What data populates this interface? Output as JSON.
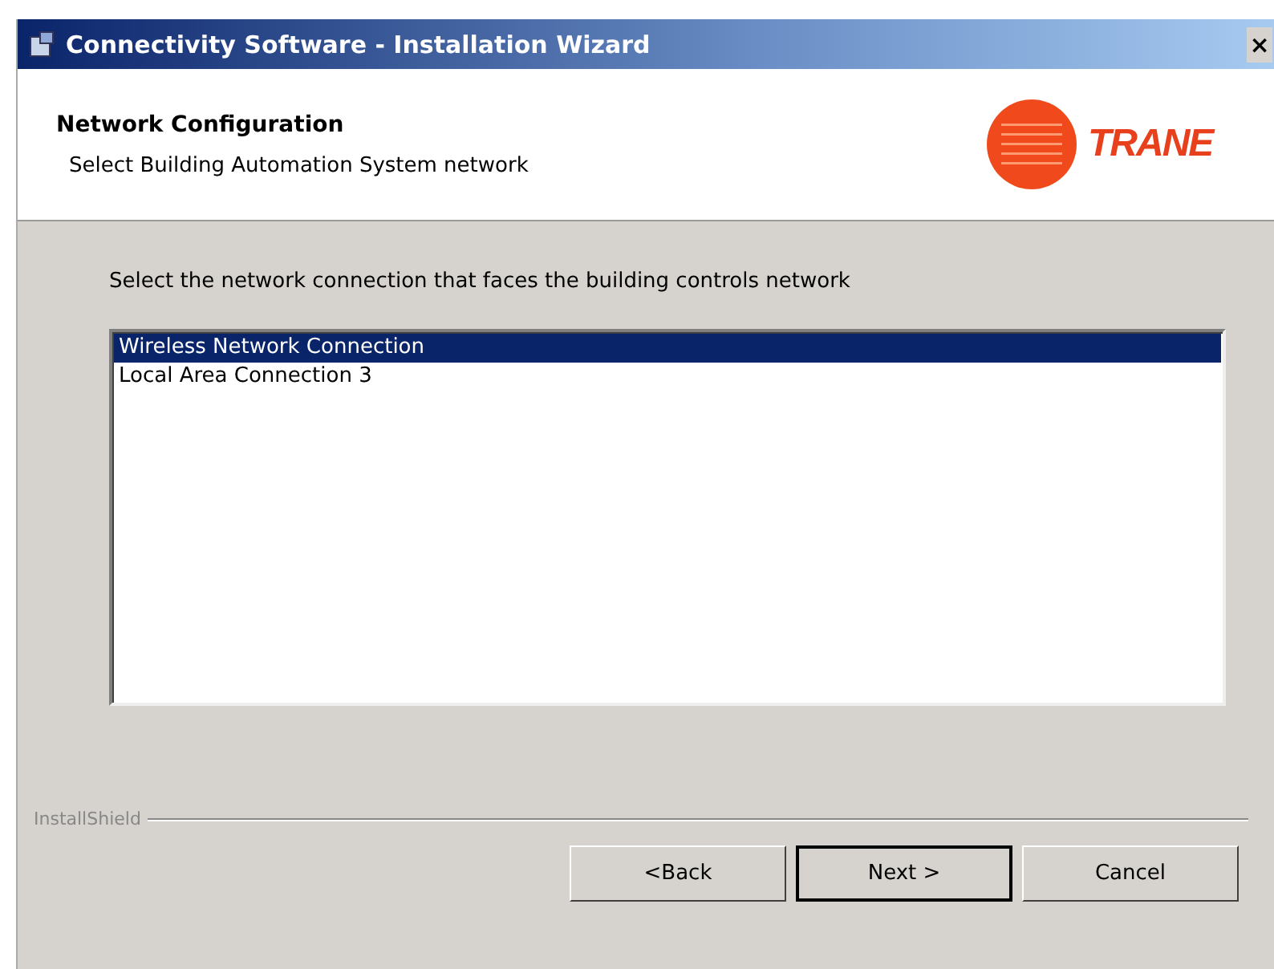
{
  "window": {
    "title": "Connectivity Software - Installation Wizard",
    "close": "×"
  },
  "header": {
    "title": "Network Configuration",
    "subtitle": "Select Building Automation System network",
    "logo": "TRANE"
  },
  "prompt": "Select the network connection that faces the building controls network",
  "connections": [
    {
      "label": "Wireless Network Connection",
      "selected": true
    },
    {
      "label": "Local Area Connection 3",
      "selected": false
    }
  ],
  "brand": "InstallShield",
  "buttons": [
    {
      "label": "<Back",
      "default": false
    },
    {
      "label": "Next >",
      "default": true
    },
    {
      "label": "Cancel",
      "default": false
    }
  ]
}
